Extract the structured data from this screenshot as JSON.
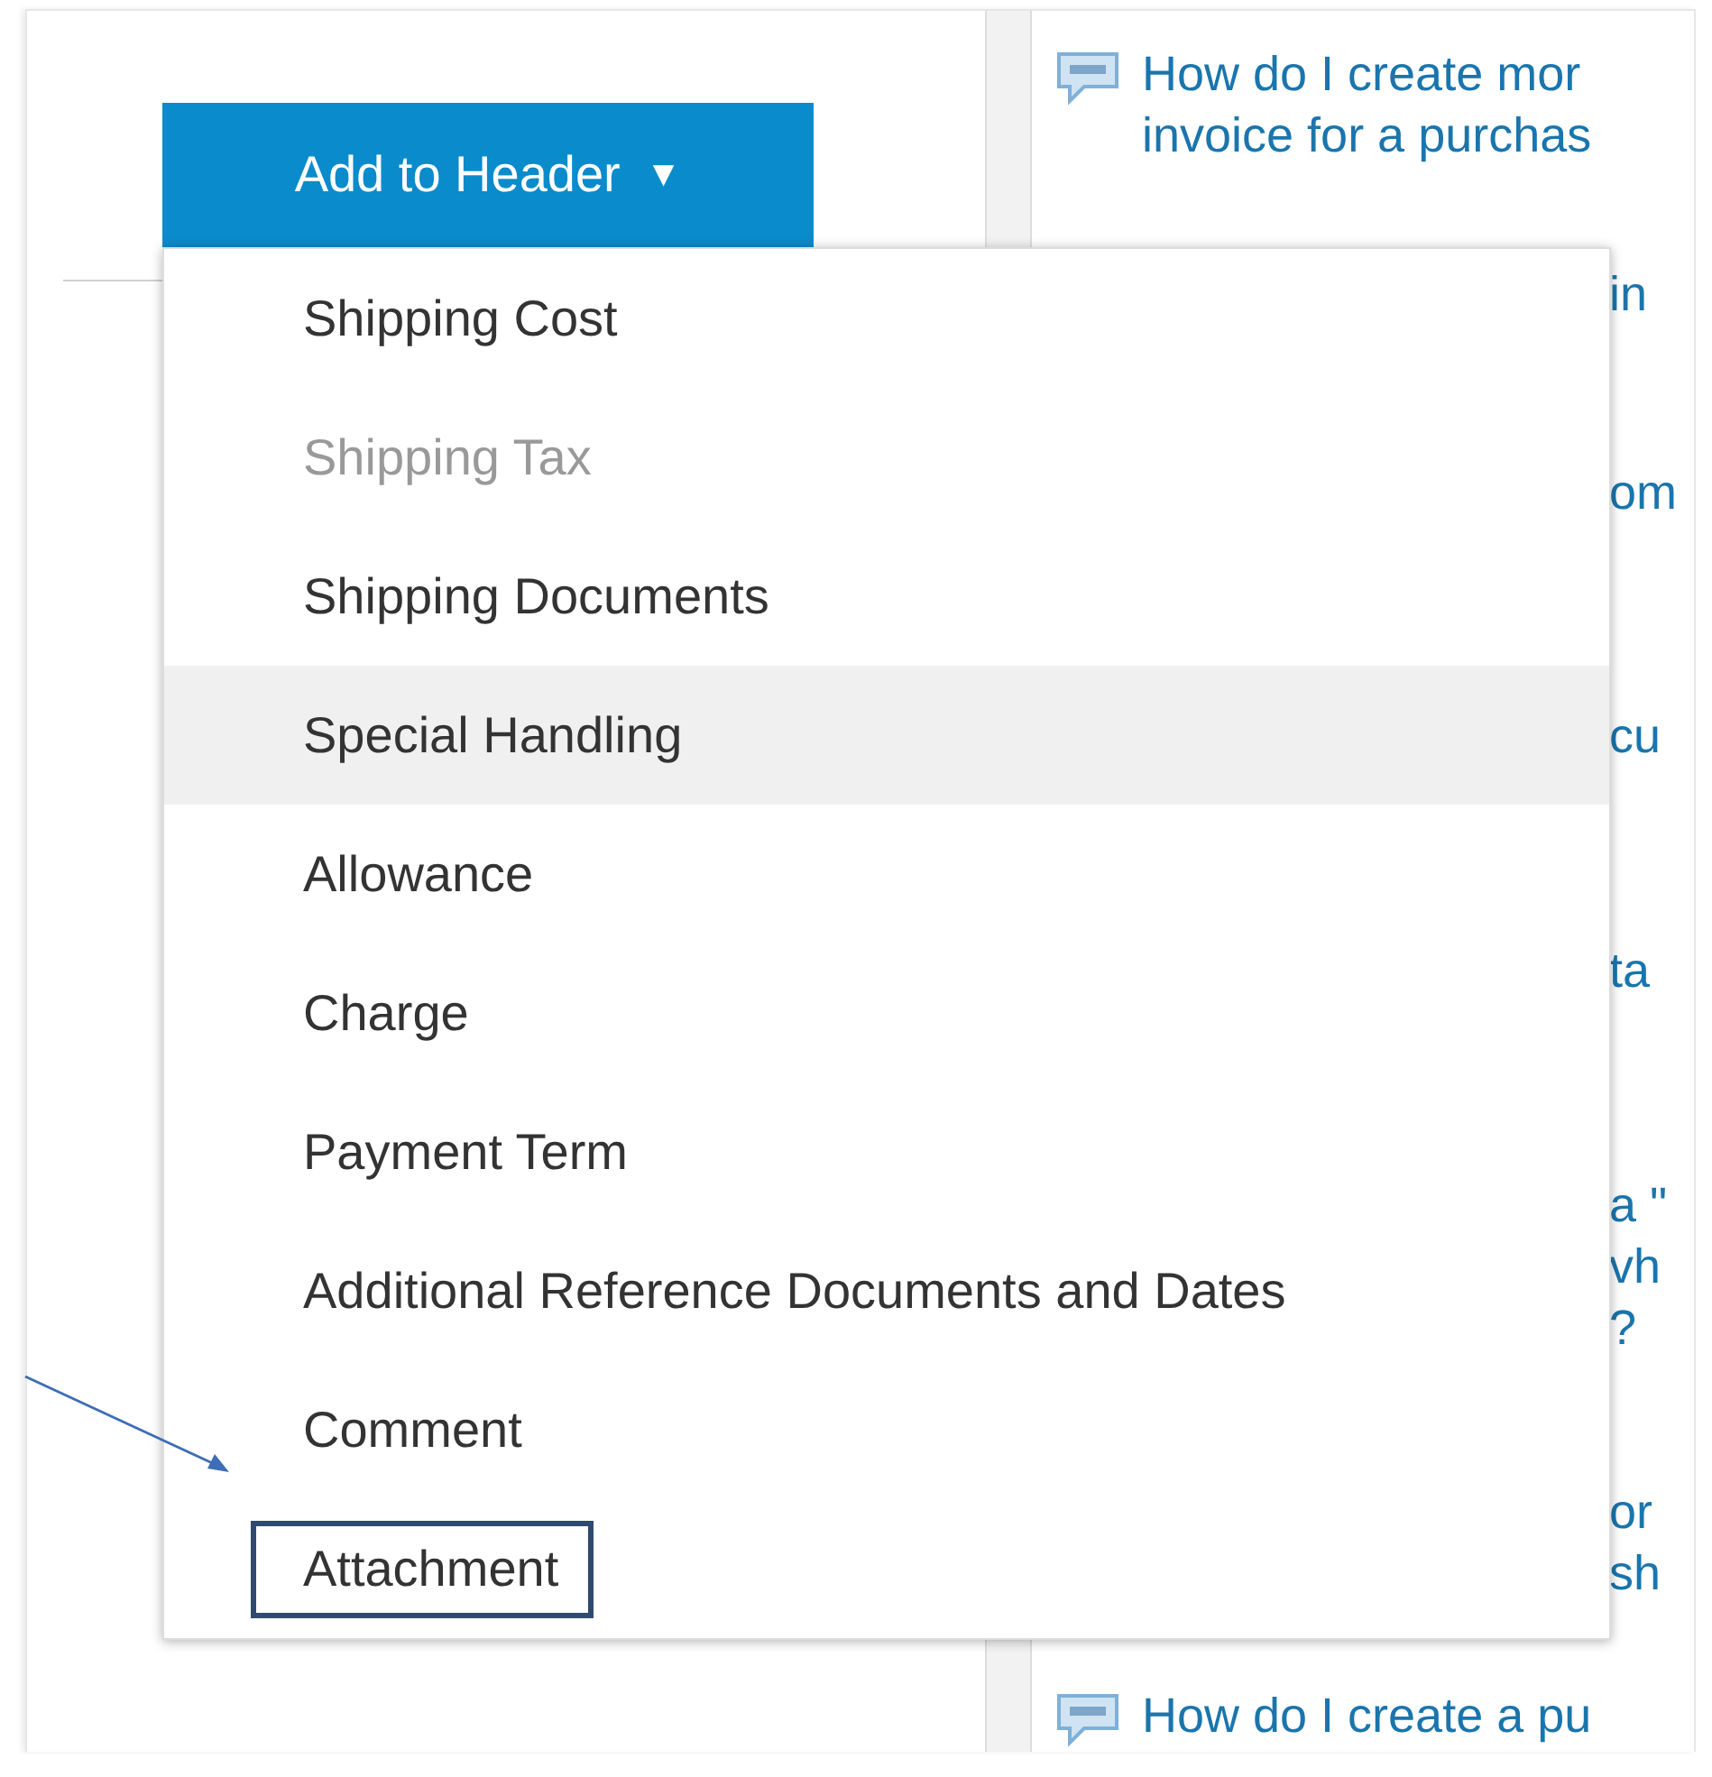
{
  "add_button": {
    "label": "Add to Header",
    "caret": "▼"
  },
  "menu": {
    "items": [
      {
        "label": "Shipping Cost",
        "disabled": false,
        "highlighted": false,
        "outlined": false
      },
      {
        "label": "Shipping Tax",
        "disabled": true,
        "highlighted": false,
        "outlined": false
      },
      {
        "label": "Shipping Documents",
        "disabled": false,
        "highlighted": false,
        "outlined": false
      },
      {
        "label": "Special Handling",
        "disabled": false,
        "highlighted": true,
        "outlined": false
      },
      {
        "label": "Allowance",
        "disabled": false,
        "highlighted": false,
        "outlined": false
      },
      {
        "label": "Charge",
        "disabled": false,
        "highlighted": false,
        "outlined": false
      },
      {
        "label": "Payment Term",
        "disabled": false,
        "highlighted": false,
        "outlined": false
      },
      {
        "label": "Additional Reference Documents and Dates",
        "disabled": false,
        "highlighted": false,
        "outlined": false
      },
      {
        "label": "Comment",
        "disabled": false,
        "highlighted": false,
        "outlined": false
      },
      {
        "label": "Attachment",
        "disabled": false,
        "highlighted": false,
        "outlined": true
      }
    ]
  },
  "faq": [
    {
      "kind": "link",
      "lines": [
        "How do I create mor",
        "invoice for a purchas"
      ]
    },
    {
      "kind": "fragment",
      "lines": [
        "in"
      ]
    },
    {
      "kind": "fragment",
      "lines": [
        "om"
      ]
    },
    {
      "kind": "fragment",
      "lines": [
        "cu"
      ]
    },
    {
      "kind": "fragment",
      "lines": [
        "ta"
      ]
    },
    {
      "kind": "fragment",
      "lines": [
        "a \"",
        "vh",
        "?"
      ]
    },
    {
      "kind": "fragment",
      "lines": [
        "or",
        "sh"
      ]
    },
    {
      "kind": "link",
      "lines": [
        "How do I create a pu"
      ]
    }
  ]
}
